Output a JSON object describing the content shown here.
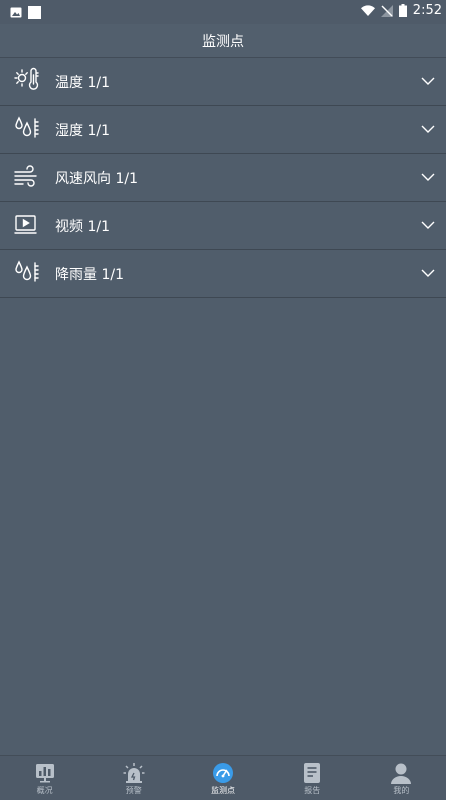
{
  "statusbar": {
    "time": "2:52"
  },
  "header": {
    "title": "监测点"
  },
  "list": [
    {
      "label": "温度 1/1",
      "icon": "thermometer-sun-icon"
    },
    {
      "label": "湿度 1/1",
      "icon": "humidity-drops-icon"
    },
    {
      "label": "风速风向 1/1",
      "icon": "wind-icon"
    },
    {
      "label": "视频 1/1",
      "icon": "video-monitor-icon"
    },
    {
      "label": "降雨量 1/1",
      "icon": "rain-gauge-icon"
    }
  ],
  "tabbar": {
    "items": [
      {
        "label": "概况",
        "icon": "chart-icon"
      },
      {
        "label": "预警",
        "icon": "alarm-siren-icon"
      },
      {
        "label": "监测点",
        "icon": "gauge-icon",
        "active": true
      },
      {
        "label": "报告",
        "icon": "report-icon"
      },
      {
        "label": "我的",
        "icon": "user-icon"
      }
    ]
  },
  "colors": {
    "background": "#505d6b",
    "active_tab": "#3a9be8"
  }
}
